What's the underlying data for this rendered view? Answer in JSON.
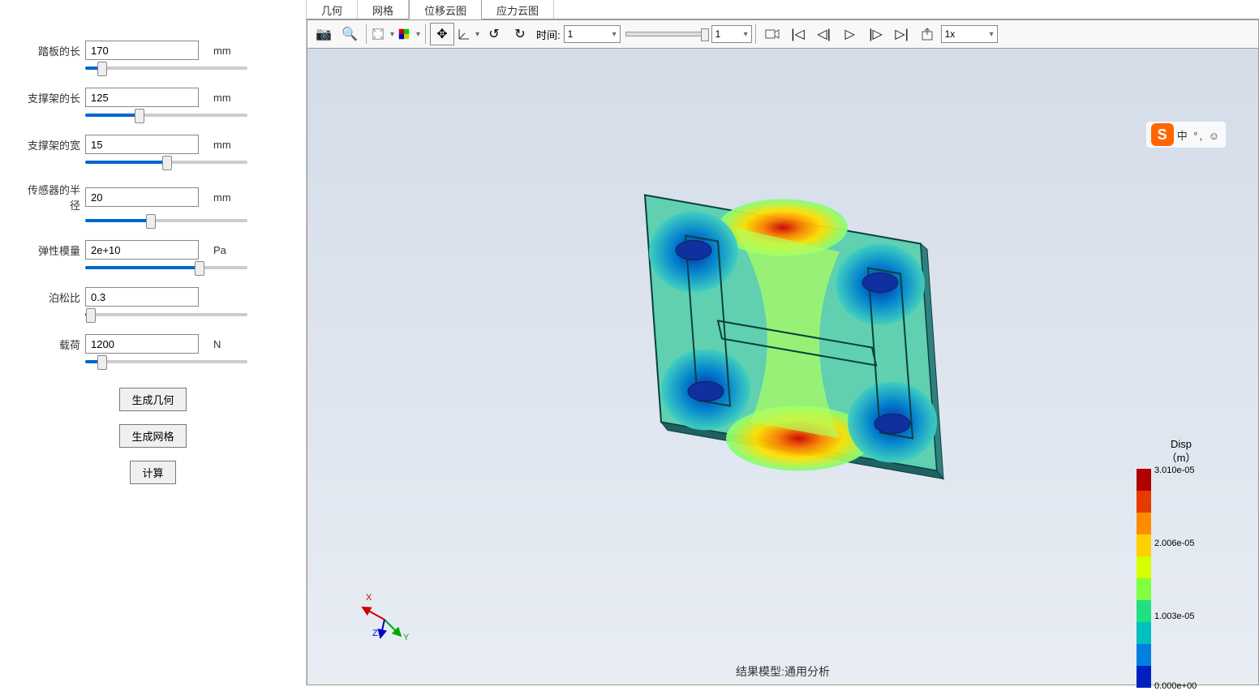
{
  "sidebar": {
    "params": [
      {
        "label": "踏板的长",
        "value": "170",
        "unit": "mm",
        "slider_pct": 10
      },
      {
        "label": "支撑架的长",
        "value": "125",
        "unit": "mm",
        "slider_pct": 33
      },
      {
        "label": "支撑架的宽",
        "value": "15",
        "unit": "mm",
        "slider_pct": 50
      },
      {
        "label": "传感器的半径",
        "value": "20",
        "unit": "mm",
        "slider_pct": 40
      },
      {
        "label": "弹性模量",
        "value": "2e+10",
        "unit": "Pa",
        "slider_pct": 70
      },
      {
        "label": "泊松比",
        "value": "0.3",
        "unit": "",
        "slider_pct": 3
      },
      {
        "label": "载荷",
        "value": "1200",
        "unit": "N",
        "slider_pct": 10
      }
    ],
    "buttons": {
      "generate_geometry": "生成几何",
      "generate_mesh": "生成网格",
      "calculate": "计算"
    }
  },
  "tabs": [
    "几何",
    "网格",
    "位移云图",
    "应力云图"
  ],
  "active_tab_index": 2,
  "toolbar": {
    "time_label": "时间:",
    "time_value": "1",
    "frame_value": "1",
    "speed_value": "1x"
  },
  "legend": {
    "title_line1": "Disp",
    "title_line2": "（m）",
    "max": "3.010e-05",
    "mid_high": "2.006e-05",
    "mid_low": "1.003e-05",
    "min": "0.000e+00",
    "colors": [
      "#b00000",
      "#e63a00",
      "#ff8c00",
      "#ffd000",
      "#d8ff00",
      "#80ff40",
      "#20e080",
      "#00c0c0",
      "#0080e0",
      "#0020c0"
    ]
  },
  "footer": "结果模型:通用分析",
  "ime": {
    "logo": "S",
    "text": "中 °, ☺"
  },
  "axis_labels": {
    "x": "X",
    "y": "Y",
    "z": "Z"
  }
}
